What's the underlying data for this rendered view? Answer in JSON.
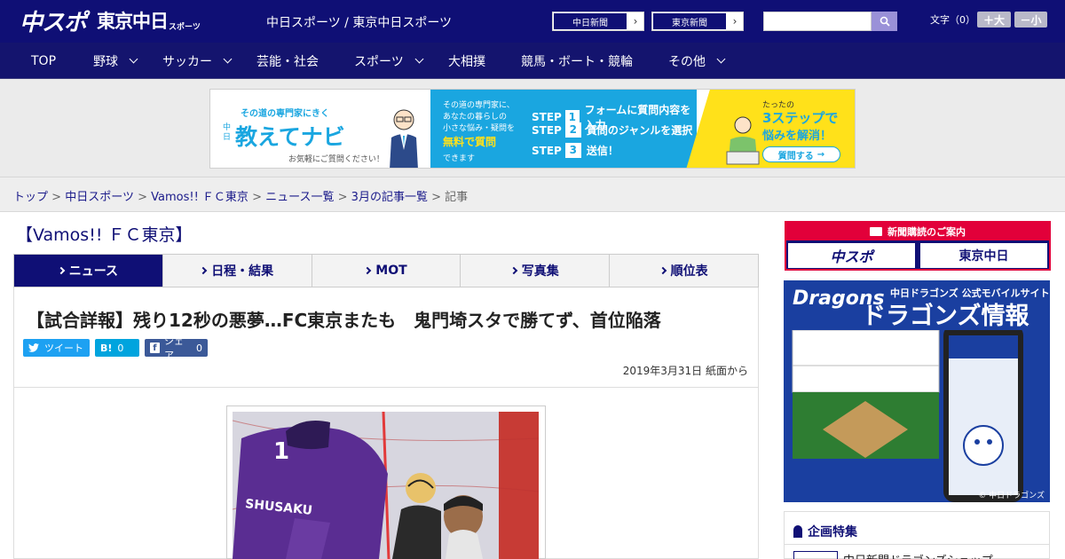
{
  "header": {
    "logo_main": "中スポ",
    "logo_sub": "東京中日",
    "logo_sub_small": "スポーツ",
    "site_title": "中日スポーツ / 東京中日スポーツ",
    "links": [
      {
        "label": "中日新聞"
      },
      {
        "label": "東京新聞"
      }
    ],
    "search_placeholder": "",
    "font_size_label": "文字（0）",
    "font_larger": "＋大",
    "font_smaller": "－小"
  },
  "nav": {
    "items": [
      {
        "label": "TOP",
        "dropdown": false
      },
      {
        "label": "野球",
        "dropdown": true
      },
      {
        "label": "サッカー",
        "dropdown": true
      },
      {
        "label": "芸能・社会",
        "dropdown": false
      },
      {
        "label": "スポーツ",
        "dropdown": true
      },
      {
        "label": "大相撲",
        "dropdown": false
      },
      {
        "label": "競馬・ボート・競輪",
        "dropdown": false
      },
      {
        "label": "その他",
        "dropdown": true
      }
    ]
  },
  "ad": {
    "tagline": "その道の専門家にきく",
    "brand_small": "中日",
    "brand": "教えてナビ",
    "note": "お気軽にご質問ください！",
    "mid_lines": [
      "その道の専門家に、",
      "あなたの暮らしの",
      "小さな悩み・疑問を"
    ],
    "mid_highlight": "無料で質問",
    "mid_last": "できます",
    "steps": [
      {
        "label": "STEP",
        "num": "1",
        "text": "フォームに質問内容を入力"
      },
      {
        "label": "STEP",
        "num": "2",
        "text": "質問のジャンルを選択"
      },
      {
        "label": "STEP",
        "num": "3",
        "text": "送信！"
      }
    ],
    "right_small": "たったの",
    "right_main": "3ステップで",
    "right_sub": "悩みを解消！",
    "cta": "質問する"
  },
  "breadcrumb": {
    "items": [
      "トップ",
      "中日スポーツ",
      "Vamos!! ＦＣ東京",
      "ニュース一覧",
      "3月の記事一覧"
    ],
    "current": "記事",
    "separator": ">"
  },
  "section": {
    "title": "【Vamos!! ＦＣ東京】"
  },
  "tabs": [
    {
      "label": "ニュース",
      "active": true
    },
    {
      "label": "日程・結果",
      "active": false
    },
    {
      "label": "MOT",
      "active": false
    },
    {
      "label": "写真集",
      "active": false
    },
    {
      "label": "順位表",
      "active": false
    }
  ],
  "article": {
    "title": "【試合詳報】残り12秒の悪夢…FC東京またも　鬼門埼スタで勝てず、首位陥落",
    "share": {
      "tweet_label": "ツイート",
      "hatena_label": "B!",
      "hatena_count": "0",
      "fb_label": "シェア",
      "fb_count": "0"
    },
    "date": "2019年3月31日 紙面から",
    "photo_jersey_name": "SHUSAKU",
    "photo_jersey_number": "1"
  },
  "sidebar": {
    "subscribe_header": "新聞購読のご案内",
    "sub_buttons": [
      "中スポ",
      "東京中日"
    ],
    "dragons_brand": "Dragons",
    "dragons_caption": "中日ドラゴンズ 公式モバイルサイト",
    "dragons_title": "ドラゴンズ情報",
    "dragons_copyright": "© 中日ドラゴンズ",
    "feature_header": "企画特集",
    "feature_item": "中日新聞ドラゴンズショップ"
  },
  "colors": {
    "brand_navy": "#0f0f75",
    "accent_red": "#e2003a",
    "twitter": "#1da1f2",
    "hatena": "#00a4de",
    "facebook": "#3b5998"
  }
}
